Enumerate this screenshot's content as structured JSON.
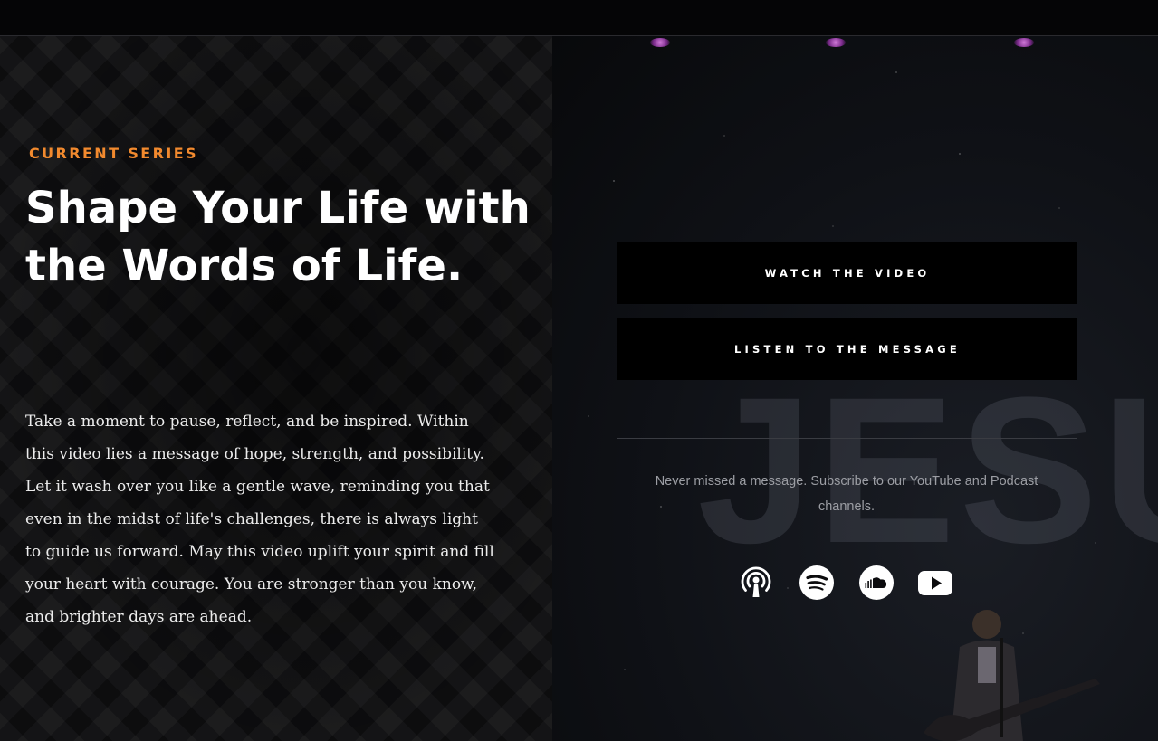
{
  "hero": {
    "series_label": "CURRENT SERIES",
    "title": "Shape Your Life with the Words of Life.",
    "description": "Take a moment to pause, reflect, and be inspired. Within this video lies a message of hope, strength, and possibility. Let it wash over you like a gentle wave, reminding you that even in the midst of life's challenges, there is always light to guide us forward. May this video uplift your spirit and fill your heart with courage. You are stronger than you know, and brighter days are ahead."
  },
  "background": {
    "word": "JESU"
  },
  "actions": {
    "watch_label": "WATCH THE VIDEO",
    "listen_label": "LISTEN TO THE MESSAGE"
  },
  "subscribe": {
    "text": "Never missed a message. Subscribe to our YouTube and Podcast channels."
  },
  "social_icons": [
    "podcast-icon",
    "spotify-icon",
    "soundcloud-icon",
    "youtube-icon"
  ],
  "colors": {
    "accent": "#f28a2e",
    "button_bg": "#000000",
    "page_bg": "#0b0b0d",
    "muted_text": "#9c9ea4"
  }
}
